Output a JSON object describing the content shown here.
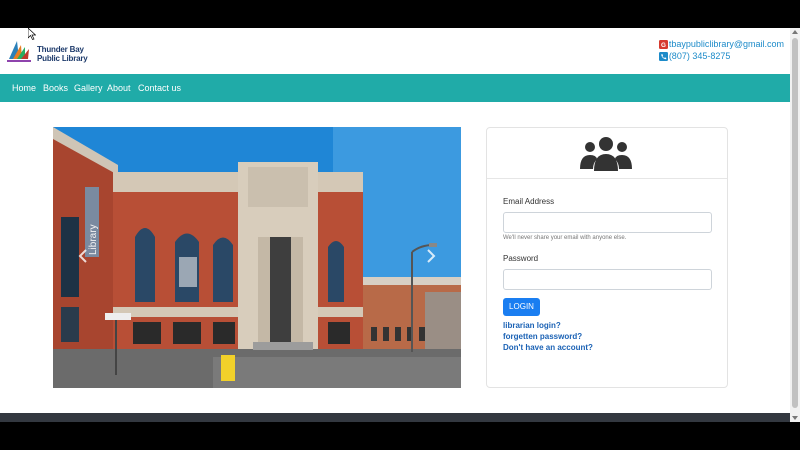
{
  "header": {
    "logo_line1": "Thunder Bay",
    "logo_line2": "Public Library",
    "email": "tbaypubliclibrary@gmail.com",
    "phone": "(807) 345-8275"
  },
  "nav": {
    "items": [
      "Home",
      "Books",
      "Gallery",
      "About",
      "Contact us"
    ]
  },
  "hero": {
    "building_sign": "Library"
  },
  "login": {
    "email_label": "Email Address",
    "email_value": "",
    "email_help": "We'll never share your email with anyone else.",
    "password_label": "Password",
    "password_value": "",
    "login_button": "LOGIN",
    "links": [
      "librarian login?",
      "forgetten password?",
      "Don't have an account?"
    ]
  },
  "colors": {
    "nav_bg": "#20aba8",
    "primary_button": "#1a7ef1",
    "link": "#1b62b5",
    "contact_text": "#1d8bc9"
  }
}
